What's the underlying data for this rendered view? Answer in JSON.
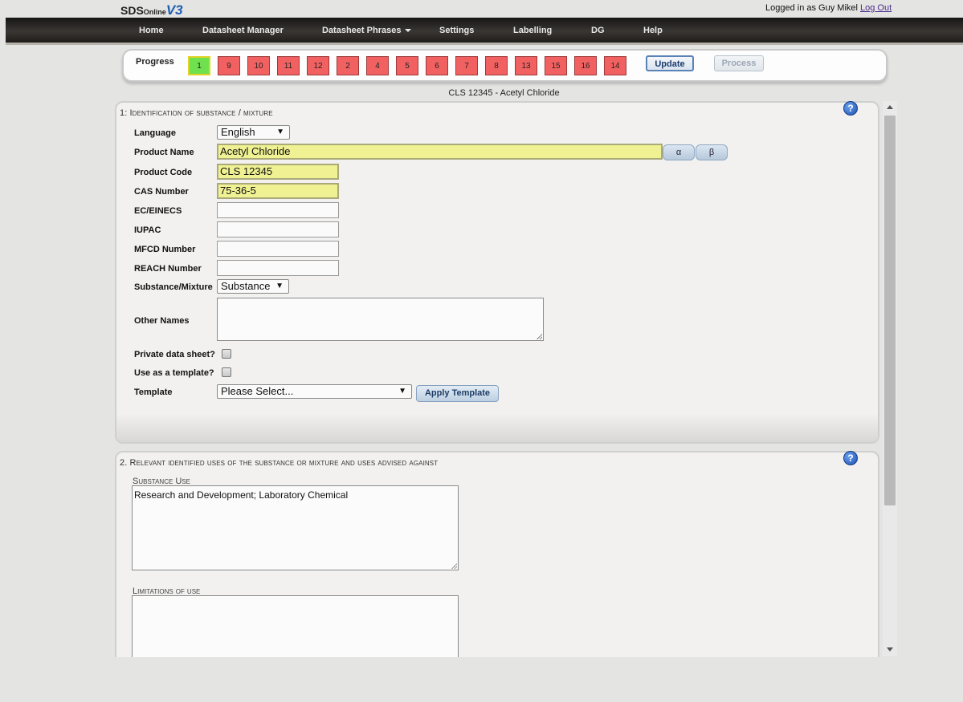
{
  "header": {
    "logo_sds": "SDS",
    "logo_online": "Online",
    "logo_v3": "V3",
    "login_text": "Logged in as Guy Mikel",
    "logout_label": "Log Out"
  },
  "nav": {
    "items": [
      {
        "label": "Home"
      },
      {
        "label": "Datasheet Manager"
      },
      {
        "label": "Datasheet Phrases"
      },
      {
        "label": "Settings"
      },
      {
        "label": "Labelling"
      },
      {
        "label": "DG"
      },
      {
        "label": "Help"
      }
    ]
  },
  "progress": {
    "label": "Progress",
    "steps": [
      "1",
      "9",
      "10",
      "11",
      "12",
      "2",
      "4",
      "5",
      "6",
      "7",
      "8",
      "13",
      "15",
      "16",
      "14"
    ],
    "active_step": "1",
    "update_label": "Update",
    "process_label": "Process"
  },
  "doc_title": "CLS 12345 - Acetyl Chloride",
  "section1": {
    "title": "1: Identification of substance / mixture",
    "help": "?",
    "fields": {
      "language_label": "Language",
      "language_value": "English",
      "product_name_label": "Product Name",
      "product_name_value": "Acetyl Chloride",
      "alpha_label": "α",
      "beta_label": "β",
      "product_code_label": "Product Code",
      "product_code_value": "CLS 12345",
      "cas_label": "CAS Number",
      "cas_value": "75-36-5",
      "ec_label": "EC/EINECS",
      "ec_value": "",
      "iupac_label": "IUPAC",
      "iupac_value": "",
      "mfcd_label": "MFCD Number",
      "mfcd_value": "",
      "reach_label": "REACH Number",
      "reach_value": "",
      "substance_label": "Substance/Mixture",
      "substance_value": "Substance",
      "other_names_label": "Other Names",
      "other_names_value": "",
      "private_label": "Private data sheet?",
      "template_flag_label": "Use as a template?",
      "template_label": "Template",
      "template_value": "Please Select...",
      "apply_template_label": "Apply Template"
    }
  },
  "section2": {
    "title": "2. Relevant identified uses of the substance or mixture and uses advised against",
    "help": "?",
    "substance_use_label": "Substance Use",
    "substance_use_value": "Research and Development; Laboratory Chemical",
    "limitations_label": "Limitations of use",
    "limitations_value": ""
  },
  "colors": {
    "step_incomplete": "#f26161",
    "step_complete": "#6fe14e",
    "filled_input": "#eff193",
    "nav_bg": "#2a2725"
  }
}
